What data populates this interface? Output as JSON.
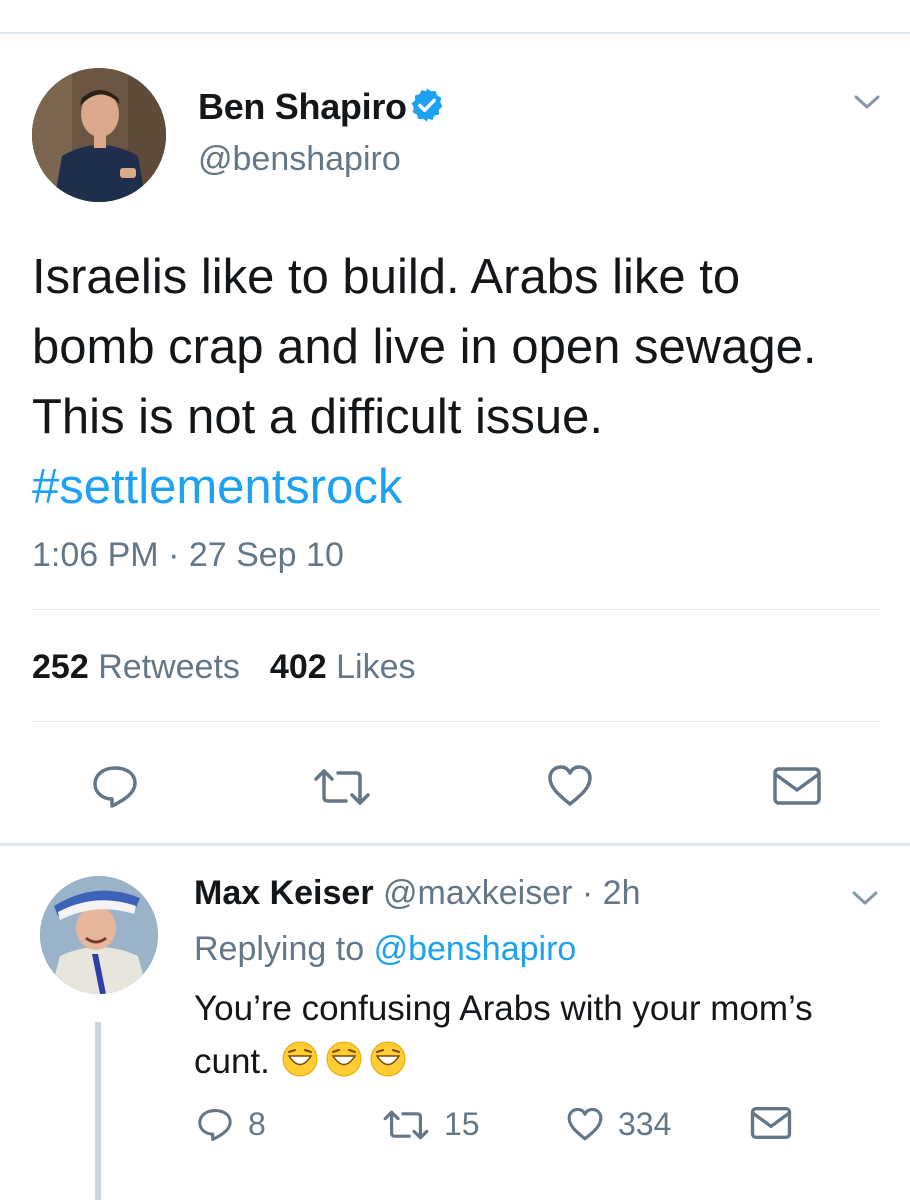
{
  "main_tweet": {
    "author_name": "Ben Shapiro",
    "handle": "@benshapiro",
    "text_before": "Israelis like to build. Arabs like to bomb crap and live in open sewage. This is not a difficult issue. ",
    "hashtag": "#settlementsrock",
    "timestamp": "1:06 PM · 27 Sep 10",
    "retweets_count": "252",
    "retweets_label": "Retweets",
    "likes_count": "402",
    "likes_label": "Likes"
  },
  "reply": {
    "author_name": "Max Keiser",
    "handle_time": "@maxkeiser · 2h",
    "replying_prefix": "Replying to",
    "replying_to": "@benshapiro",
    "text": "You’re confusing Arabs with your mom’s cunt.",
    "reply_count": "8",
    "retweet_count": "15",
    "like_count": "334"
  },
  "colors": {
    "accent": "#1da1f2",
    "muted": "#657786",
    "divider": "#e1e8ed"
  }
}
